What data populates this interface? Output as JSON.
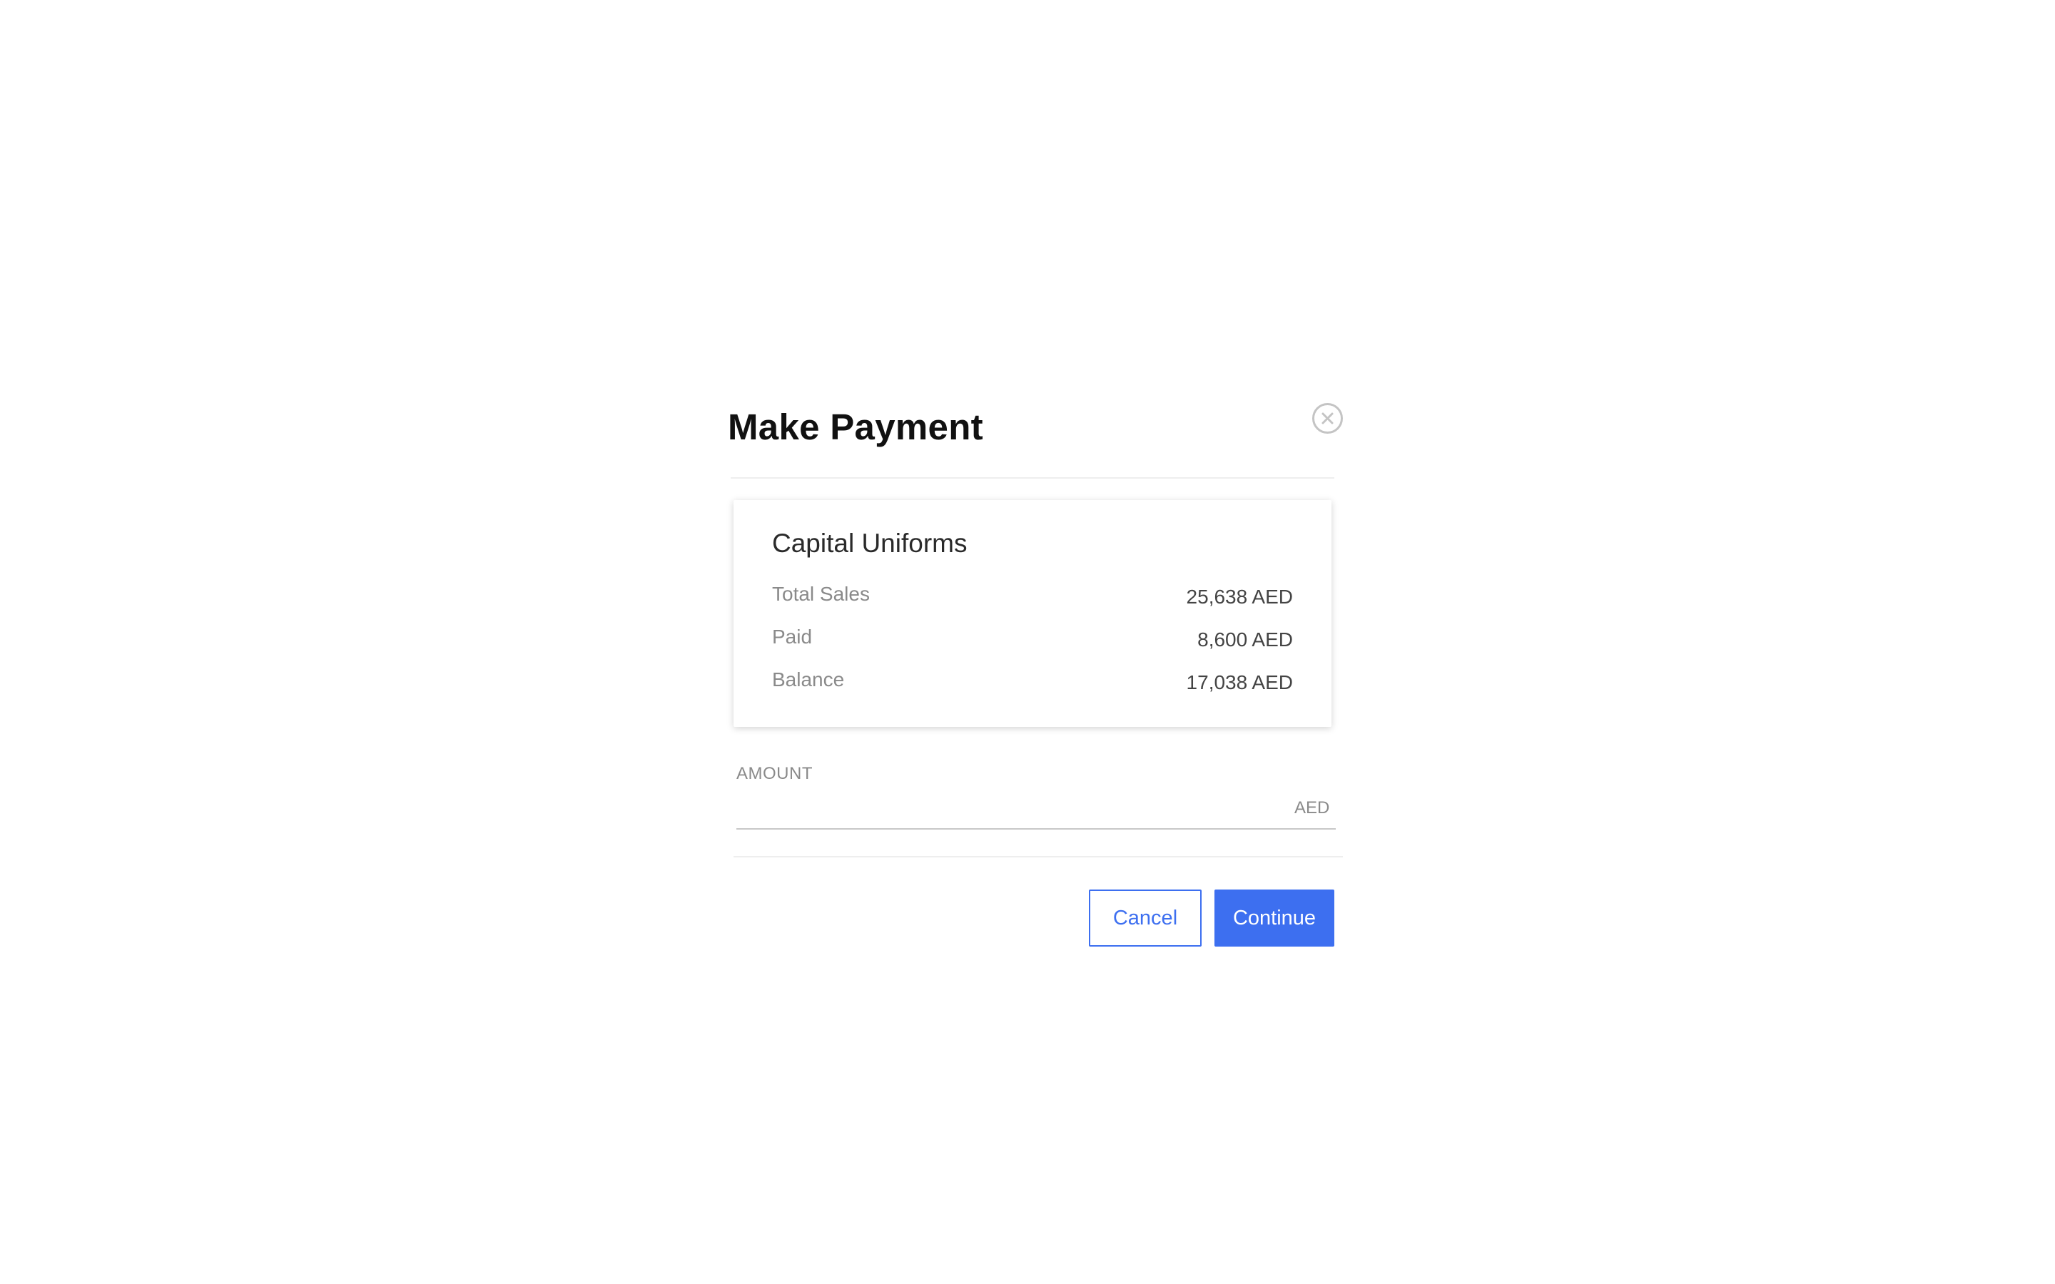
{
  "dialog": {
    "title": "Make Payment",
    "close_icon": "close-circle-icon"
  },
  "summary": {
    "vendor_name": "Capital Uniforms",
    "rows": [
      {
        "label": "Total Sales",
        "value": "25,638 AED"
      },
      {
        "label": "Paid",
        "value": "8,600 AED"
      },
      {
        "label": "Balance",
        "value": "17,038 AED"
      }
    ]
  },
  "amount": {
    "label": "AMOUNT",
    "value": "",
    "placeholder": "",
    "currency": "AED"
  },
  "actions": {
    "cancel_label": "Cancel",
    "continue_label": "Continue"
  },
  "colors": {
    "accent": "#3d6ff0",
    "background": "#ffffff"
  }
}
